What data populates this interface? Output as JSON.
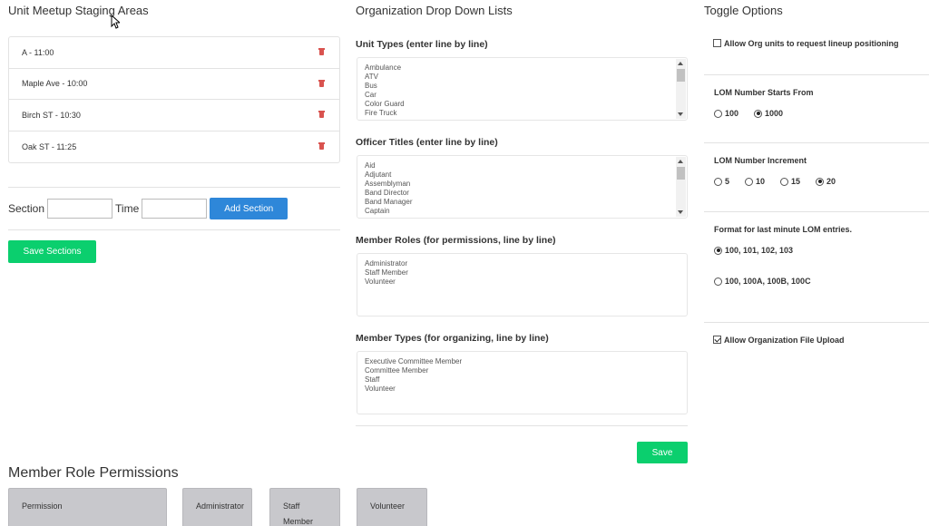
{
  "staging": {
    "title": "Unit Meetup Staging Areas",
    "items": [
      {
        "label": "A - 11:00"
      },
      {
        "label": "Maple Ave - 10:00"
      },
      {
        "label": "Birch ST - 10:30"
      },
      {
        "label": "Oak ST - 11:25"
      }
    ],
    "section_label": "Section",
    "section_value": "",
    "time_label": "Time",
    "time_value": "",
    "add_section_label": "Add Section",
    "save_sections_label": "Save Sections"
  },
  "dropdowns": {
    "title": "Organization Drop Down Lists",
    "unit_types": {
      "label": "Unit Types (enter line by line)",
      "lines": [
        "Ambulance",
        "ATV",
        "Bus",
        "Car",
        "Color Guard",
        "Fire Truck"
      ]
    },
    "officer_titles": {
      "label": "Officer Titles (enter line by line)",
      "lines": [
        "Aid",
        "Adjutant",
        "Assemblyman",
        "Band Director",
        "Band Manager",
        "Captain"
      ]
    },
    "member_roles": {
      "label": "Member Roles (for permissions, line by line)",
      "lines": [
        "Administrator",
        "Staff Member",
        "Volunteer"
      ]
    },
    "member_types": {
      "label": "Member Types (for organizing, line by line)",
      "lines": [
        "Executive Committee Member",
        "Committee Member",
        "Staff",
        "Volunteer"
      ]
    },
    "save_label": "Save"
  },
  "toggles": {
    "title": "Toggle Options",
    "allow_lineup": {
      "label": "Allow Org units to request lineup positioning",
      "checked": false
    },
    "lom_start": {
      "label": "LOM Number Starts From",
      "options": [
        "100",
        "1000"
      ],
      "selected": "1000"
    },
    "lom_increment": {
      "label": "LOM Number Increment",
      "options": [
        "5",
        "10",
        "15",
        "20"
      ],
      "selected": "20"
    },
    "last_minute_format": {
      "label": "Format for last minute LOM entries.",
      "options": [
        "100, 101, 102, 103",
        "100, 100A, 100B, 100C"
      ],
      "selected": "100, 101, 102, 103"
    },
    "allow_file_upload": {
      "label": "Allow Organization File Upload",
      "checked": true
    }
  },
  "permissions": {
    "title": "Member Role Permissions",
    "headers": [
      "Permission",
      "Administrator",
      "Staff Member",
      "Volunteer"
    ]
  },
  "colors": {
    "primary_blue": "#2e87d9",
    "success_green": "#0bcf6e",
    "delete_red": "#d9534f"
  }
}
